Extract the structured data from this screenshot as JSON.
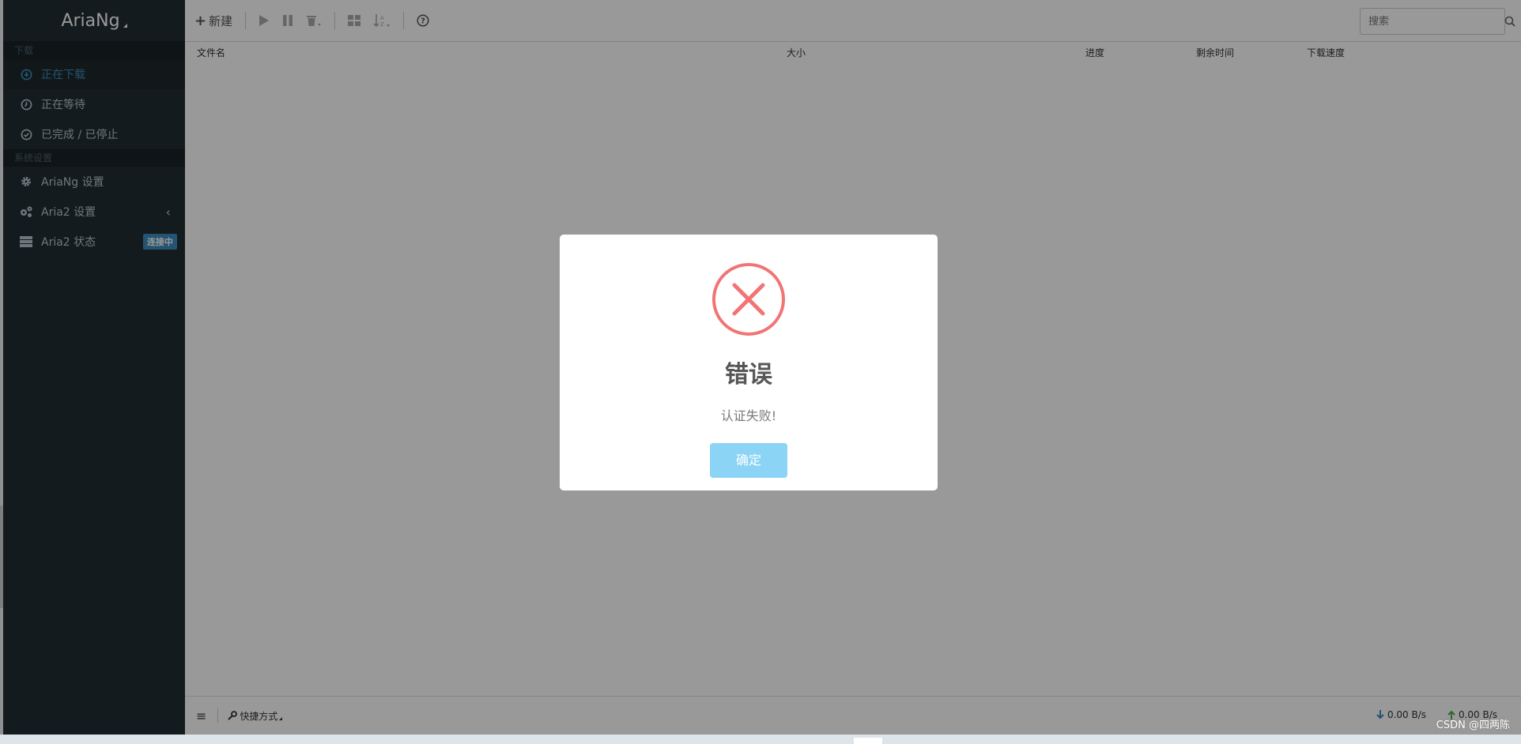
{
  "app": {
    "logo": "AriaNg"
  },
  "sidebar": {
    "download_header": "下载",
    "items": [
      {
        "label": "正在下载",
        "icon": "download-circle-icon"
      },
      {
        "label": "正在等待",
        "icon": "clock-icon"
      },
      {
        "label": "已完成 / 已停止",
        "icon": "check-circle-icon"
      }
    ],
    "settings_header": "系统设置",
    "settings_items": [
      {
        "label": "AriaNg 设置",
        "icon": "gear-icon"
      },
      {
        "label": "Aria2 设置",
        "icon": "gears-icon"
      },
      {
        "label": "Aria2 状态",
        "icon": "server-icon",
        "badge": "连接中"
      }
    ]
  },
  "toolbar": {
    "new_label": "新建",
    "search_placeholder": "搜索"
  },
  "table": {
    "columns": [
      "文件名",
      "大小",
      "进度",
      "剩余时间",
      "下载速度"
    ]
  },
  "footer": {
    "shortcut_label": "快捷方式",
    "download_speed": "0.00 B/s",
    "upload_speed": "0.00 B/s"
  },
  "modal": {
    "title": "错误",
    "message": "认证失败!",
    "ok_label": "确定",
    "error_color": "#f27474",
    "button_color": "#8cd4f5"
  },
  "watermark": "CSDN @四两陈"
}
